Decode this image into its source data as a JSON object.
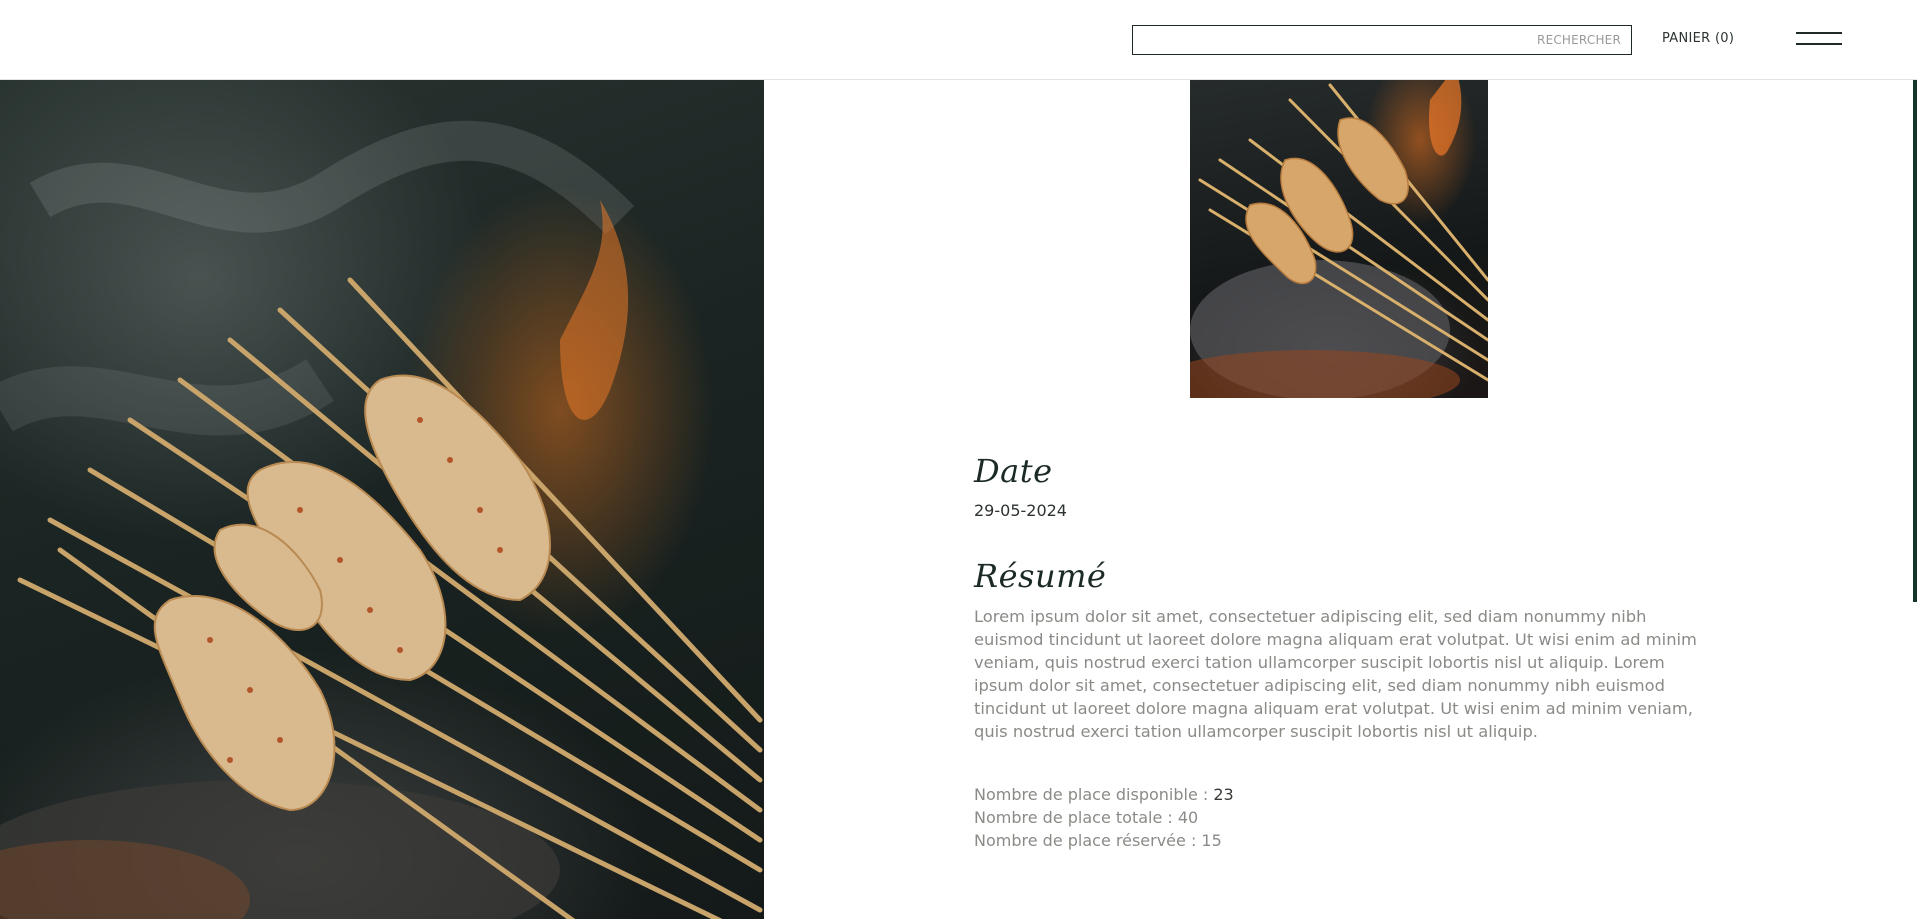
{
  "header": {
    "search_placeholder": "RECHERCHER",
    "cart_label": "PANIER (0)",
    "menu_icon": "hamburger-menu-icon"
  },
  "hero_image": {
    "subject": "grilled skewers over smoke and flames"
  },
  "event": {
    "date_heading": "Date",
    "date_value": "29-05-2024",
    "summary_heading": "Résumé",
    "summary_text": "Lorem ipsum dolor sit amet, consectetuer adipiscing elit, sed diam nonummy nibh euismod tincidunt ut laoreet dolore magna aliquam erat volutpat. Ut wisi enim ad minim veniam, quis nostrud exerci tation ullamcorper suscipit lobortis nisl ut aliquip. Lorem ipsum dolor sit amet, consectetuer adipiscing elit, sed diam nonummy nibh euismod tincidunt ut laoreet dolore magna aliquam erat volutpat. Ut wisi enim ad minim veniam, quis nostrud exerci tation ullamcorper suscipit lobortis nisl ut aliquip.",
    "stats": [
      {
        "label": "Nombre de place disponible : ",
        "value": "23"
      },
      {
        "label": "Nombre de place totale : ",
        "value": "40"
      },
      {
        "label": "Nombre de place réservée : ",
        "value": "15"
      }
    ]
  },
  "colors": {
    "accent": "#14352a",
    "heading": "#1b2a24",
    "body_text": "#8a8a86"
  }
}
